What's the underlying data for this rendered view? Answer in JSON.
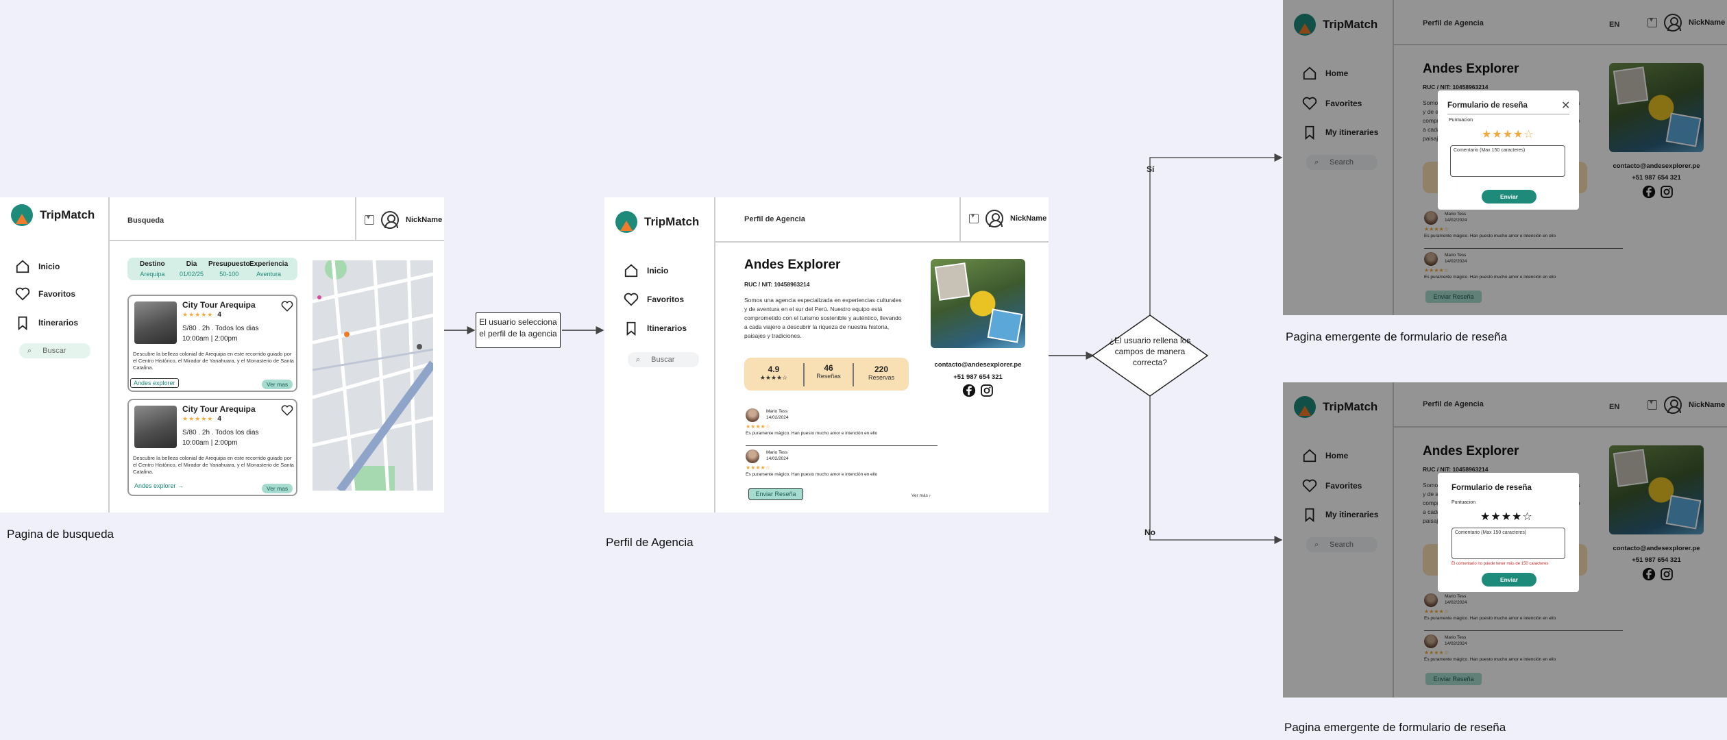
{
  "app": {
    "name": "TripMatch",
    "user": "NickName",
    "lang": "EN"
  },
  "colors": {
    "accent": "#1e8a7a",
    "accent_soft": "#a6dccf",
    "star": "#f2a93b",
    "stat_bg": "#f9dfb4",
    "error": "#d02a2a",
    "canvas": "#f0f0fa"
  },
  "search_page": {
    "tab": "Busqueda",
    "nav": [
      {
        "label": "Inicio",
        "icon": "home-icon"
      },
      {
        "label": "Favoritos",
        "icon": "heart-icon"
      },
      {
        "label": "Itinerarios",
        "icon": "bookmark-icon"
      }
    ],
    "search_label": "Buscar",
    "filters": [
      {
        "header": "Destino",
        "value": "Arequipa"
      },
      {
        "header": "Dia",
        "value": "01/02/25"
      },
      {
        "header": "Presupuesto",
        "value": "50-100"
      },
      {
        "header": "Experiencia",
        "value": "Aventura"
      }
    ],
    "cards": [
      {
        "title": "City Tour Arequipa",
        "stars": "★★★★★",
        "rating": "4",
        "price_line": "S/80 . 2h . Todos los dias",
        "time_line": "10:00am | 2:00pm",
        "description": "Descubre la belleza colonial de Arequipa en este recorrido guiado por el Centro Histórico, el Mirador de Yanahuara, y el Monasterio de Santa Catalina.",
        "agency_link": "Andes explorer",
        "more": "Ver mas"
      },
      {
        "title": "City Tour Arequipa",
        "stars": "★★★★★",
        "rating": "4",
        "price_line": "S/80 . 2h . Todos los dias",
        "time_line": "10:00am | 2:00pm",
        "description": "Descubre la belleza colonial de Arequipa en este recorrido guiado por el Centro Histórico, el Mirador de Yanahuara, y el Monasterio de Santa Catalina.",
        "agency_link": "Andes explorer  →",
        "more": "Ver mas"
      }
    ],
    "caption": "Pagina de busqueda"
  },
  "flow": {
    "step1": "El usuario selecciona el perfil de la agencia",
    "decision": "¿El usuario rellena los campos de manera correcta?",
    "yes": "Sí",
    "no": "No"
  },
  "agency_page": {
    "tab": "Perfil de Agencia",
    "nav": [
      {
        "label": "Inicio",
        "icon": "home-icon"
      },
      {
        "label": "Favoritos",
        "icon": "heart-icon"
      },
      {
        "label": "Itinerarios",
        "icon": "bookmark-icon"
      }
    ],
    "search_label": "Buscar",
    "name": "Andes Explorer",
    "ruc": "RUC / NIT: 10458963214",
    "description": "Somos una agencia especializada en experiencias culturales y de aventura en el sur del Perú. Nuestro equipo está comprometido con el turismo sostenible y auténtico, llevando a cada viajero a descubrir la riqueza de nuestra historia, paisajes y tradiciones.",
    "stats": [
      {
        "value": "4.9",
        "label": "★★★★☆"
      },
      {
        "value": "46",
        "label": "Reseñas"
      },
      {
        "value": "220",
        "label": "Reservas"
      }
    ],
    "email": "contacto@andesexplorer.pe",
    "phone": "+51 987 654 321",
    "reviews": [
      {
        "name": "Mario Tess",
        "date": "14/02/2024",
        "stars": "★★★★☆",
        "text": "Es puramente mágico. Han puesto mucho amor e intención en ello"
      },
      {
        "name": "Mario Tess",
        "date": "14/02/2024",
        "stars": "★★★★☆",
        "text": "Es puramente mágico. Han puesto mucho amor e intención en ello"
      }
    ],
    "send_review": "Enviar Reseña",
    "see_more": "Ver más   ›",
    "caption": "Perfil de Agencia"
  },
  "modal_page": {
    "tab": "Perfil de Agencia",
    "nav": [
      {
        "label": "Home",
        "icon": "home-icon"
      },
      {
        "label": "Favorites",
        "icon": "heart-icon"
      },
      {
        "label": "My itineraries",
        "icon": "bookmark-icon"
      }
    ],
    "search_label": "Search",
    "form_title": "Formulario de reseña",
    "rating_label": "Puntuacion",
    "comment_placeholder": "Comentario (Max 150 caracteres)",
    "submit": "Enviar",
    "error": "El comentario no puede tener más de 150 caracteres",
    "stars_yes": "★★★★☆",
    "stars_no": "★★★★☆",
    "caption_yes": "Pagina emergente de formulario de reseña",
    "caption_no": "Pagina emergente de formulario de reseña"
  }
}
